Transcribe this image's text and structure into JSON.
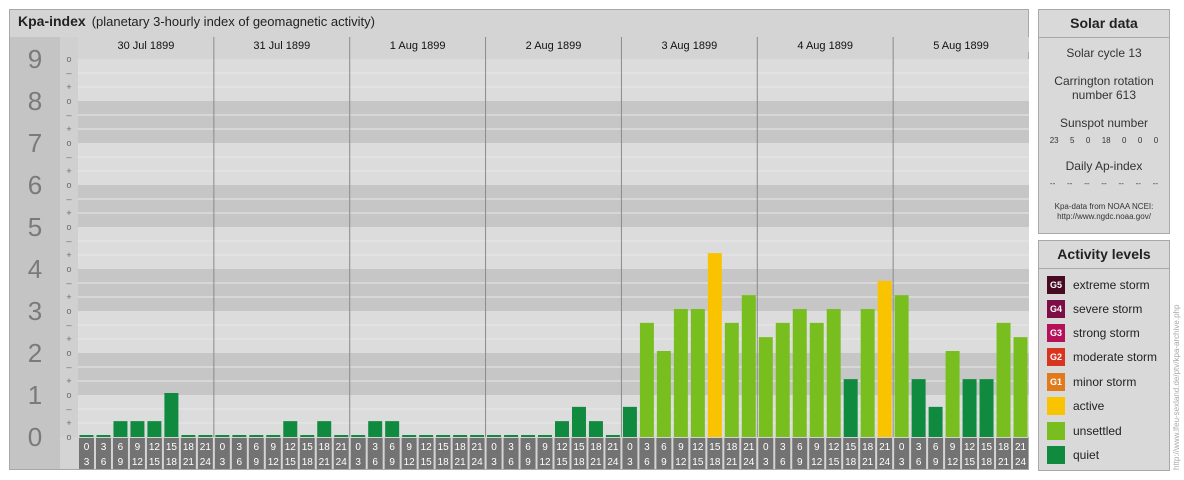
{
  "header": {
    "title": "Kpa-index",
    "subtitle": "(planetary 3-hourly index of geomagnetic activity)"
  },
  "chart_data": {
    "type": "bar",
    "title": "Kpa-index",
    "subtitle": "(planetary 3-hourly index of geomagnetic activity)",
    "ylim": [
      0,
      9
    ],
    "y_ticks": [
      "0",
      "1",
      "2",
      "3",
      "4",
      "5",
      "6",
      "7",
      "8",
      "9"
    ],
    "sub_ticks": [
      "o",
      "+",
      "–"
    ],
    "days": [
      "30 Jul 1899",
      "31 Jul 1899",
      "1 Aug 1899",
      "2 Aug 1899",
      "3 Aug 1899",
      "4 Aug 1899",
      "5 Aug 1899"
    ],
    "hour_starts": [
      "0",
      "3",
      "6",
      "9",
      "12",
      "15",
      "18",
      "21"
    ],
    "hour_ends": [
      "3",
      "6",
      "9",
      "12",
      "15",
      "18",
      "21",
      "24"
    ],
    "series": [
      {
        "values": [
          0,
          0,
          0.33,
          0.33,
          0.33,
          1,
          0,
          0,
          0,
          0,
          0,
          0,
          0.33,
          0,
          0.33,
          0,
          0,
          0.33,
          0.33,
          0,
          0,
          0,
          0,
          0,
          0,
          0,
          0,
          0,
          0.33,
          0.67,
          0.33,
          0,
          0.67,
          2.67,
          2,
          3,
          3,
          4.33,
          2.67,
          3.33,
          2.33,
          2.67,
          3,
          2.67,
          3,
          1.33,
          3,
          3.67,
          3.33,
          1.33,
          0.67,
          2,
          1.33,
          1.33,
          2.67,
          2.33
        ]
      }
    ],
    "colors": {
      "quiet": "#0f8a3e",
      "unsettled": "#79be1f",
      "active": "#f9c300",
      "minor_storm": "#e07a1b",
      "moderate_storm": "#d9341e",
      "strong_storm": "#b5115a",
      "severe_storm": "#7d0e45",
      "extreme_storm": "#470a22"
    }
  },
  "solar": {
    "title": "Solar data",
    "cycle": "Solar cycle 13",
    "carrington_1": "Carrington rotation",
    "carrington_2": "number 613",
    "sunspot_label": "Sunspot number",
    "sunspot_values": [
      "23",
      "5",
      "0",
      "18",
      "0",
      "0",
      "0"
    ],
    "ap_label": "Daily Ap-index",
    "ap_values": [
      "--",
      "--",
      "--",
      "--",
      "--",
      "--",
      "--"
    ],
    "source_1": "Kpa-data from NOAA NCEI:",
    "source_2": "http://www.ngdc.noaa.gov/"
  },
  "levels": {
    "title": "Activity levels",
    "items": [
      {
        "badge": "G5",
        "label": "extreme storm",
        "color": "#470a22"
      },
      {
        "badge": "G4",
        "label": "severe storm",
        "color": "#7d0e45"
      },
      {
        "badge": "G3",
        "label": "strong storm",
        "color": "#b5115a"
      },
      {
        "badge": "G2",
        "label": "moderate storm",
        "color": "#d9341e"
      },
      {
        "badge": "G1",
        "label": "minor storm",
        "color": "#e07a1b"
      },
      {
        "badge": "",
        "label": "active",
        "color": "#f9c300"
      },
      {
        "badge": "",
        "label": "unsettled",
        "color": "#79be1f"
      },
      {
        "badge": "",
        "label": "quiet",
        "color": "#0f8a3e"
      }
    ]
  },
  "credit": "http://www.lfeu-sexland.de/ptv/kpa-archive.php"
}
